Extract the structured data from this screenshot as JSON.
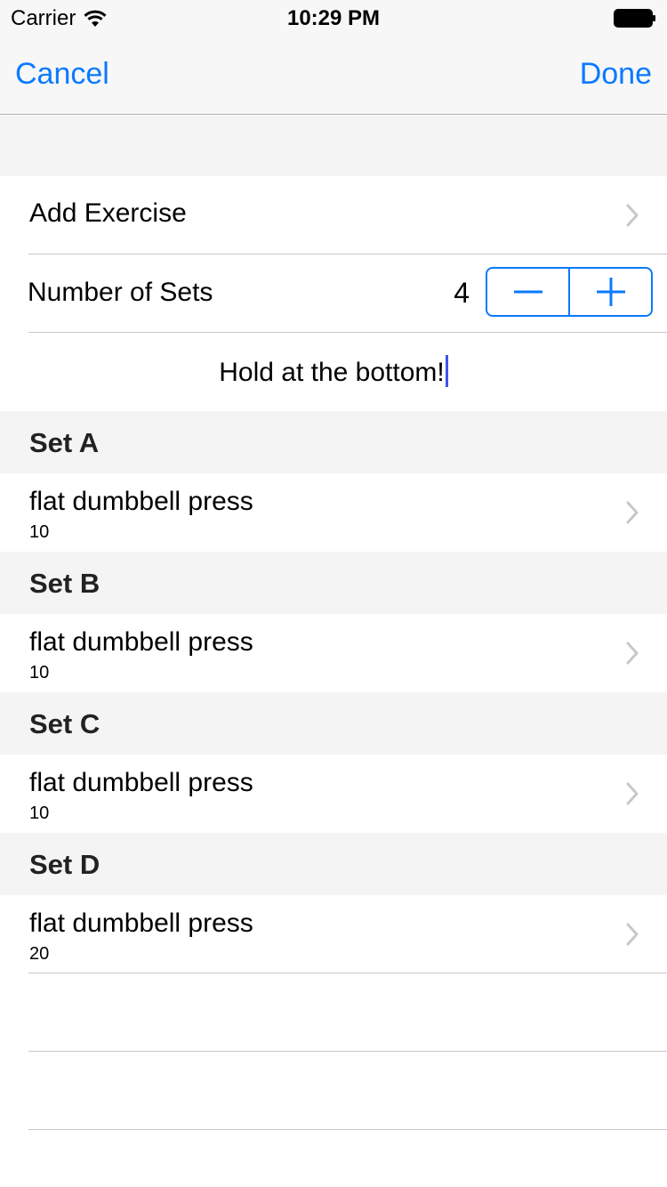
{
  "status_bar": {
    "carrier": "Carrier",
    "time": "10:29 PM",
    "wifi_icon": "wifi-icon",
    "battery_icon": "battery-icon"
  },
  "nav": {
    "cancel_label": "Cancel",
    "done_label": "Done",
    "tint_color": "#0a7aff"
  },
  "add_exercise": {
    "label": "Add Exercise"
  },
  "number_of_sets": {
    "label": "Number of Sets",
    "value": "4",
    "minus_icon": "minus-icon",
    "plus_icon": "plus-icon"
  },
  "notes": {
    "text": "Hold at the bottom!"
  },
  "sets": [
    {
      "header": "Set A",
      "exercise": "flat dumbbell press",
      "reps": "10"
    },
    {
      "header": "Set B",
      "exercise": "flat dumbbell press",
      "reps": "10"
    },
    {
      "header": "Set C",
      "exercise": "flat dumbbell press",
      "reps": "10"
    },
    {
      "header": "Set D",
      "exercise": "flat dumbbell press",
      "reps": "20"
    }
  ]
}
